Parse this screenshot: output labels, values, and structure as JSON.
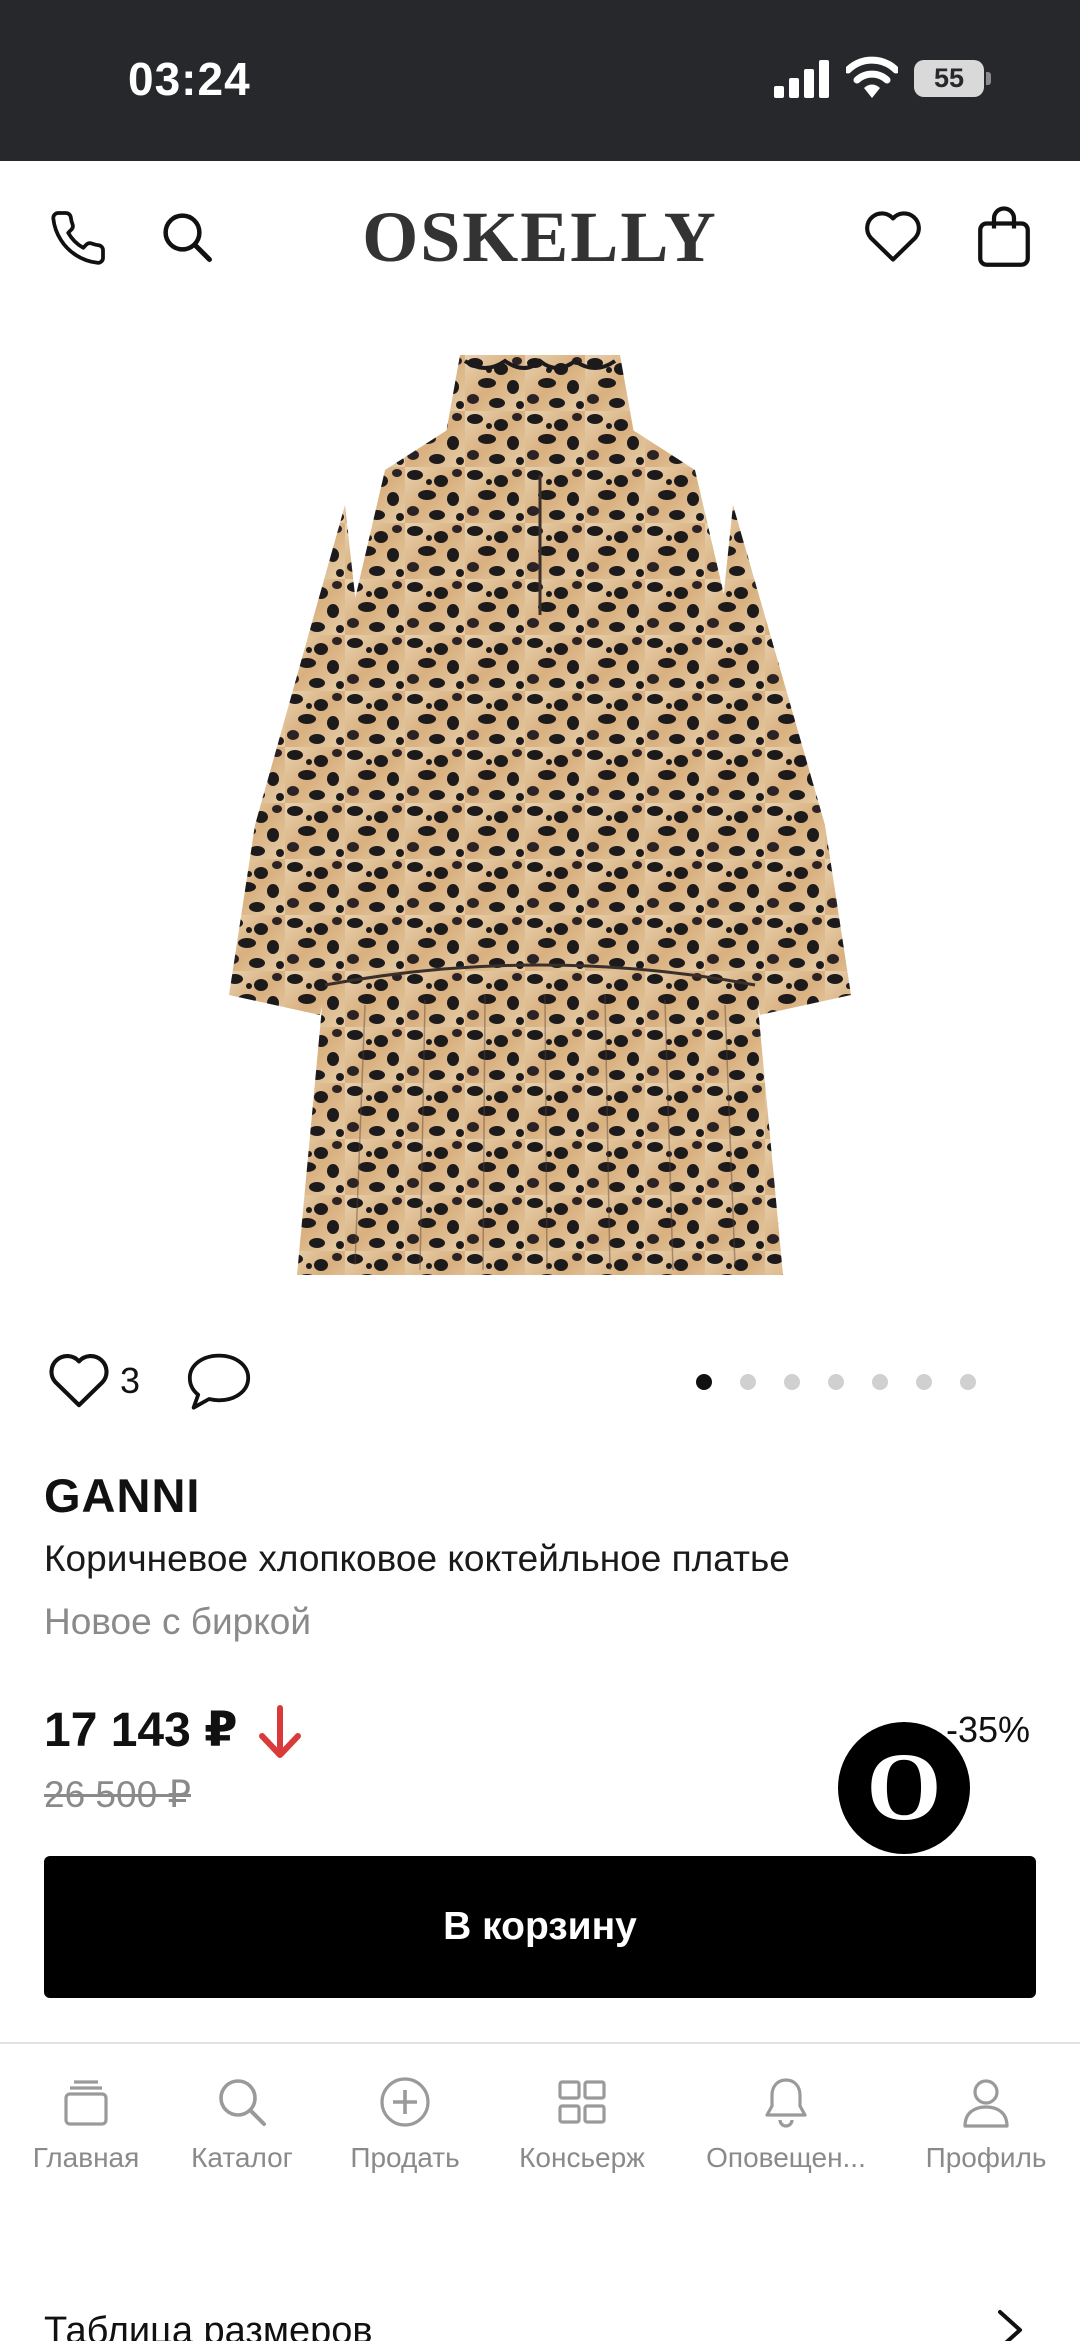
{
  "status_bar": {
    "time": "03:24",
    "battery": "55"
  },
  "header": {
    "logo": "OSKELLY"
  },
  "product": {
    "likes": "3",
    "brand": "GANNI",
    "title": "Коричневое хлопковое коктейльное платье",
    "condition": "Новое с биркой",
    "price": "17 143 ₽",
    "old_price": "26 500 ₽",
    "discount": "-35%",
    "image_slides": 7,
    "active_slide": 1
  },
  "assistant_button": {
    "label": "O"
  },
  "actions": {
    "add_to_cart": "В корзину"
  },
  "tabs": [
    {
      "label": "Главная",
      "icon": "home-stack-icon"
    },
    {
      "label": "Каталог",
      "icon": "search-icon"
    },
    {
      "label": "Продать",
      "icon": "plus-circle-icon"
    },
    {
      "label": "Консьерж",
      "icon": "grid-icon"
    },
    {
      "label": "Оповещен...",
      "icon": "bell-icon"
    },
    {
      "label": "Профиль",
      "icon": "user-icon"
    }
  ],
  "size_chart": {
    "label": "Таблица размеров"
  },
  "colors": {
    "price_drop_arrow": "#d93b3b",
    "status_bar_bg": "#26282c",
    "button_bg": "#000000"
  }
}
